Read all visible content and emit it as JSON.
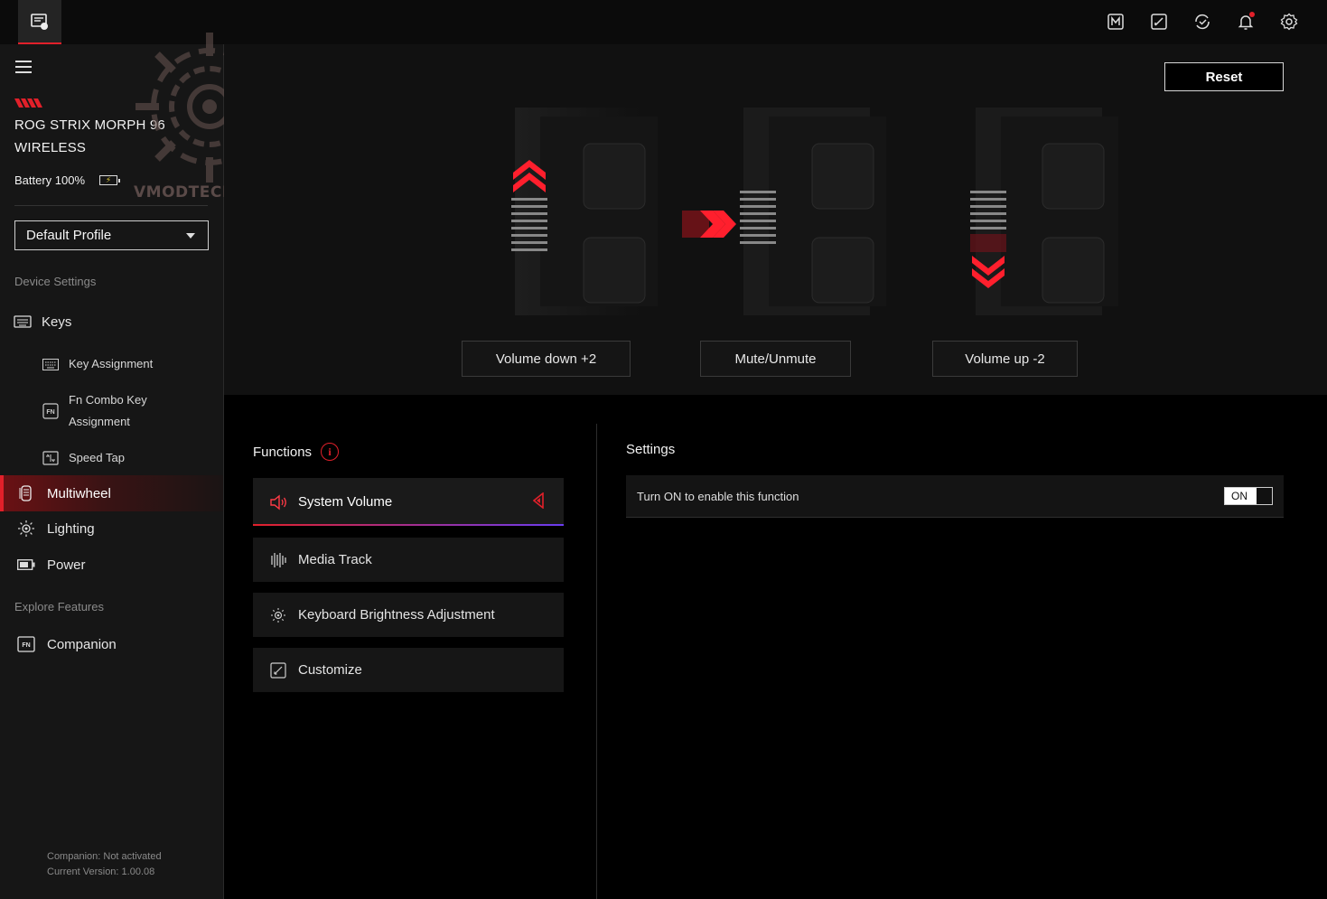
{
  "header": {
    "top_icons": [
      "macro-icon",
      "edit-icon",
      "update-icon",
      "bell-icon",
      "gear-icon"
    ]
  },
  "sidebar": {
    "device_name": "ROG STRIX MORPH 96 WIRELESS",
    "battery_label": "Battery 100%",
    "profile": {
      "selected": "Default Profile"
    },
    "device_settings_label": "Device Settings",
    "items": [
      {
        "label": "Keys",
        "icon": "keyboard-icon"
      },
      {
        "label": "Key Assignment",
        "icon": "keyboard-grid-icon"
      },
      {
        "label": "Fn Combo Key Assignment",
        "icon": "fn-key-icon"
      },
      {
        "label": "Speed Tap",
        "icon": "speed-tap-icon"
      },
      {
        "label": "Multiwheel",
        "icon": "multiwheel-icon"
      },
      {
        "label": "Lighting",
        "icon": "lighting-icon"
      },
      {
        "label": "Power",
        "icon": "battery-icon"
      }
    ],
    "explore_label": "Explore Features",
    "companion": {
      "label": "Companion",
      "icon": "fn-key-icon"
    },
    "footer": {
      "companion_status": "Companion: Not activated",
      "version": "Current Version: 1.00.08"
    }
  },
  "watermark": {
    "text": "VMODTECH.COM"
  },
  "hero": {
    "reset_label": "Reset",
    "actions": [
      {
        "label": "Volume down +2"
      },
      {
        "label": "Mute/Unmute"
      },
      {
        "label": "Volume up -2"
      }
    ]
  },
  "functions": {
    "title": "Functions",
    "items": [
      {
        "label": "System Volume",
        "icon": "speaker-icon",
        "selected": true
      },
      {
        "label": "Media Track",
        "icon": "media-track-icon",
        "selected": false
      },
      {
        "label": "Keyboard Brightness Adjustment",
        "icon": "brightness-icon",
        "selected": false
      },
      {
        "label": "Customize",
        "icon": "customize-icon",
        "selected": false
      }
    ]
  },
  "settings": {
    "title": "Settings",
    "enable_text": "Turn ON to enable this function",
    "toggle_label": "ON",
    "toggle_on": true
  },
  "colors": {
    "accent": "#e1202a",
    "accent_gradient_end": "#6a3cf0",
    "sidebar_bg": "#161616",
    "hero_bg": "#111111",
    "page_bg": "#000000"
  }
}
